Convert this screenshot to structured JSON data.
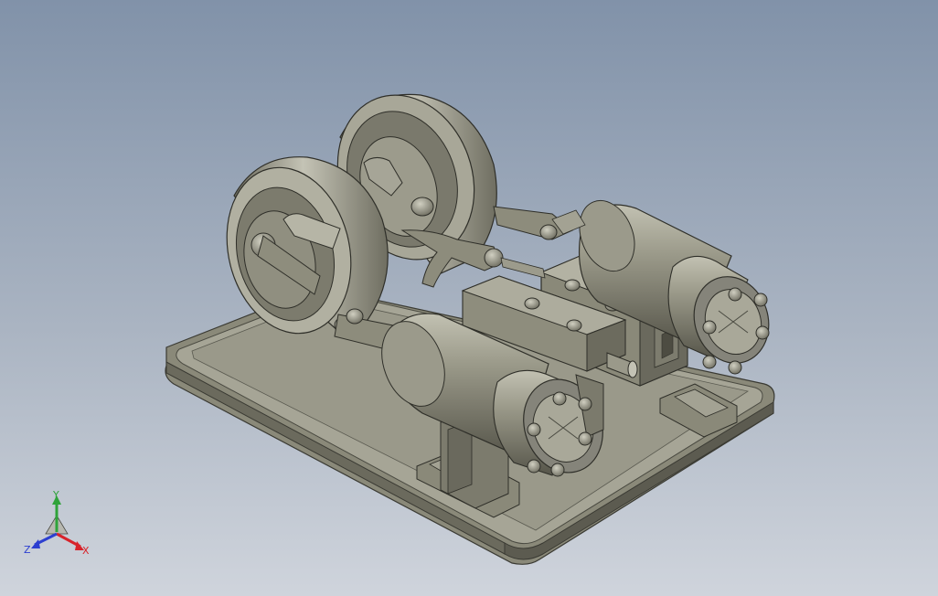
{
  "viewport": {
    "background_top": "#8596ad",
    "background_bottom": "#cdd3db",
    "part_color": "#8f8e7e"
  },
  "triad": {
    "x_label": "X",
    "y_label": "Y",
    "z_label": "Z",
    "x_color": "#d8232a",
    "y_color": "#2fa33a",
    "z_color": "#2c3fd0"
  }
}
